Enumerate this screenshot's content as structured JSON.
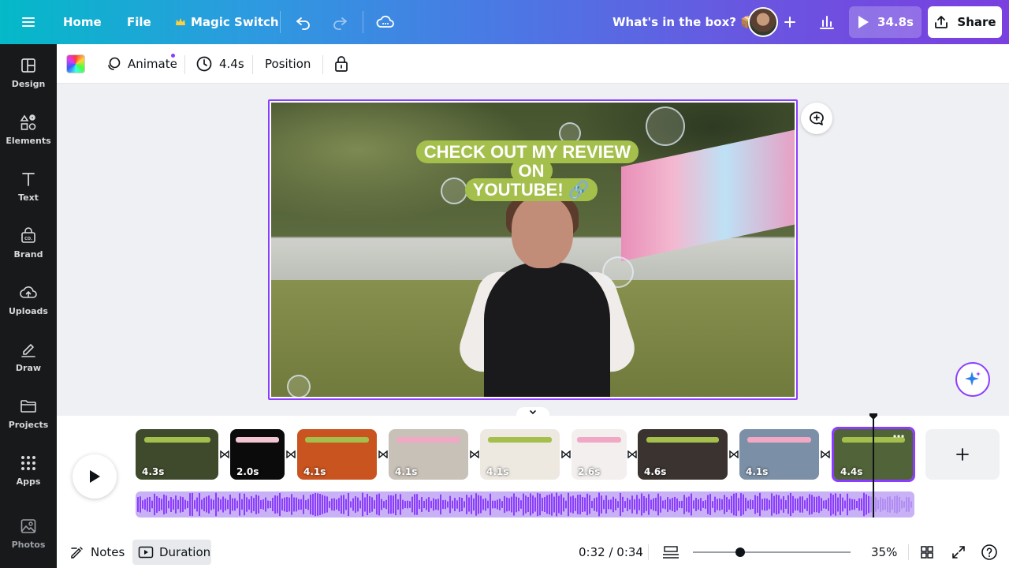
{
  "topbar": {
    "home": "Home",
    "file": "File",
    "magic_switch": "Magic Switch",
    "doc_title": "What's in the box? 📦",
    "play_duration": "34.8s",
    "share": "Share"
  },
  "rail": {
    "items": [
      {
        "label": "Design",
        "icon": "design-icon"
      },
      {
        "label": "Elements",
        "icon": "elements-icon"
      },
      {
        "label": "Text",
        "icon": "text-icon"
      },
      {
        "label": "Brand",
        "icon": "brand-icon"
      },
      {
        "label": "Uploads",
        "icon": "uploads-icon"
      },
      {
        "label": "Draw",
        "icon": "draw-icon"
      },
      {
        "label": "Projects",
        "icon": "projects-icon"
      },
      {
        "label": "Apps",
        "icon": "apps-icon"
      },
      {
        "label": "Photos",
        "icon": "photos-icon"
      }
    ]
  },
  "toolbar": {
    "animate": "Animate",
    "duration": "4.4s",
    "position": "Position"
  },
  "canvas": {
    "overlay_line1": "CHECK OUT MY REVIEW ON",
    "overlay_line2": "YOUTUBE! 🔗"
  },
  "timeline": {
    "clips": [
      {
        "duration": "4.3s",
        "bg": "#3f4a2c",
        "title_color": "#a4bf4b"
      },
      {
        "duration": "2.0s",
        "bg": "#0b0b0c",
        "title_color": "#f2c6d3"
      },
      {
        "duration": "4.1s",
        "bg": "#c9541f",
        "title_color": "#a4bf4b"
      },
      {
        "duration": "4.1s",
        "bg": "#c8c1b8",
        "title_color": "#f0a8c4"
      },
      {
        "duration": "4.1s",
        "bg": "#ede9e1",
        "title_color": "#a4bf4b"
      },
      {
        "duration": "2.6s",
        "bg": "#f2efee",
        "title_color": "#f0a8c4"
      },
      {
        "duration": "4.6s",
        "bg": "#3a3330",
        "title_color": "#a4bf4b"
      },
      {
        "duration": "4.1s",
        "bg": "#7b8fa6",
        "title_color": "#f0a8c4"
      },
      {
        "duration": "4.4s",
        "bg": "#516338",
        "title_color": "#a4bf4b"
      }
    ]
  },
  "bottombar": {
    "notes": "Notes",
    "duration": "Duration",
    "time": "0:32 / 0:34",
    "zoom": "35%",
    "zoom_level": 0.3
  },
  "colors": {
    "accent": "#8b3dff",
    "rail_bg": "#18191b",
    "overlay_green": "#a4bf4b"
  }
}
